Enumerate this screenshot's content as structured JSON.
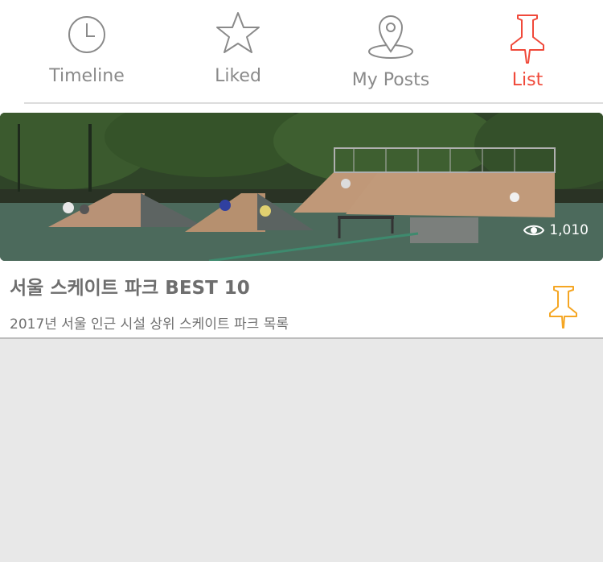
{
  "tabs": {
    "timeline": {
      "label": "Timeline",
      "icon": "clock-icon"
    },
    "liked": {
      "label": "Liked",
      "icon": "star-icon"
    },
    "my_posts": {
      "label": "My Posts",
      "icon": "map-pin-icon"
    },
    "list": {
      "label": "List",
      "icon": "push-pin-icon",
      "active": true
    }
  },
  "colors": {
    "active_tab": "#f0493a",
    "inactive_tab": "#8a8a8a",
    "pin_accent": "#f5a623",
    "background": "#e8e8e8"
  },
  "list_items": [
    {
      "image": "skate-park-photo",
      "views": "1,010",
      "title": "서울 스케이트 파크 BEST 10",
      "subtitle": "2017년 서울 인근 시설 상위 스케이트 파크 목록",
      "pin_icon": "push-pin-icon"
    }
  ]
}
